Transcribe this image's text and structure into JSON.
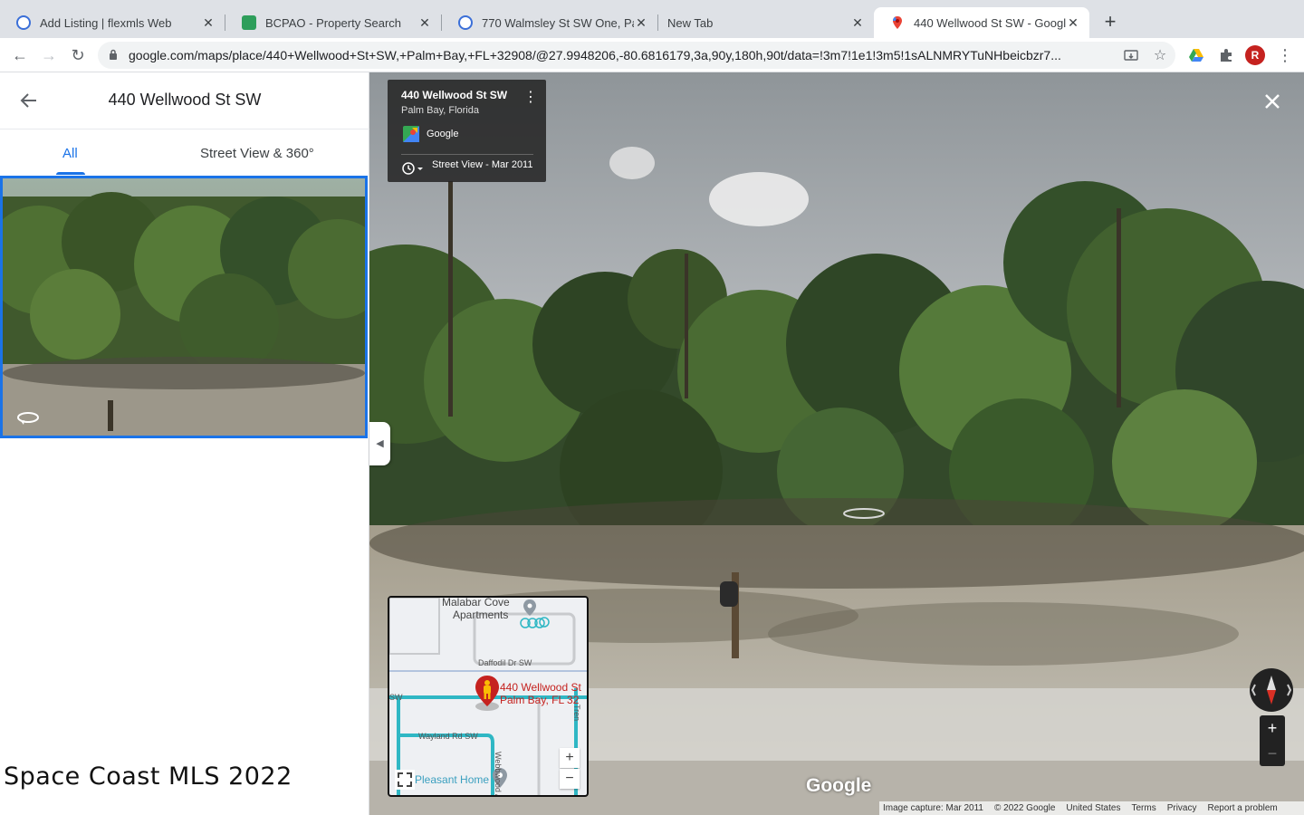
{
  "browser": {
    "tabs": [
      {
        "title": "Add Listing | flexmls Web",
        "close": "✕"
      },
      {
        "title": "BCPAO - Property Search",
        "close": "✕"
      },
      {
        "title": "770 Walmsley St SW One, Pal",
        "close": "✕"
      },
      {
        "title": "New Tab",
        "close": "✕"
      },
      {
        "title": "440 Wellwood St SW - Google",
        "close": "✕"
      }
    ],
    "new_tab": "+",
    "url": "google.com/maps/place/440+Wellwood+St+SW,+Palm+Bay,+FL+32908/@27.9948206,-80.6816179,3a,90y,180h,90t/data=!3m7!1e1!3m5!1sALNMRYTuNHbeicbzr7...",
    "profile_initial": "R"
  },
  "sidepanel": {
    "title": "440 Wellwood St SW",
    "tabs": {
      "all": "All",
      "street_view": "Street View & 360°"
    },
    "watermark": "Space Coast MLS 2022"
  },
  "streetview": {
    "info": {
      "address": "440 Wellwood St SW",
      "locality": "Palm Bay, Florida",
      "source": "Google",
      "date": "Street View - Mar 2011"
    },
    "logo": "Google",
    "footer": [
      "Image capture: Mar 2011",
      "© 2022 Google",
      "United States",
      "Terms",
      "Privacy",
      "Report a problem"
    ],
    "zoom_in": "+",
    "zoom_out": "−"
  },
  "minimap": {
    "place1_line1": "Malabar Cove",
    "place1_line2": "Apartments",
    "road1": "Daffodil Dr SW",
    "road2": "Wayland Rd SW",
    "road3": "Webbwood Ave SW",
    "road4": "Tren",
    "road_sw": "SW",
    "pin_line1": "440 Wellwood St",
    "pin_line2": "Palm Bay, FL 32",
    "place2": "Pleasant Home",
    "zoom_in": "+",
    "zoom_out": "−"
  },
  "colors": {
    "accent": "#1a73e8",
    "sky": "#c9ccd0",
    "foliage": "#3e5a2c",
    "ground": "#b9b3a4"
  }
}
